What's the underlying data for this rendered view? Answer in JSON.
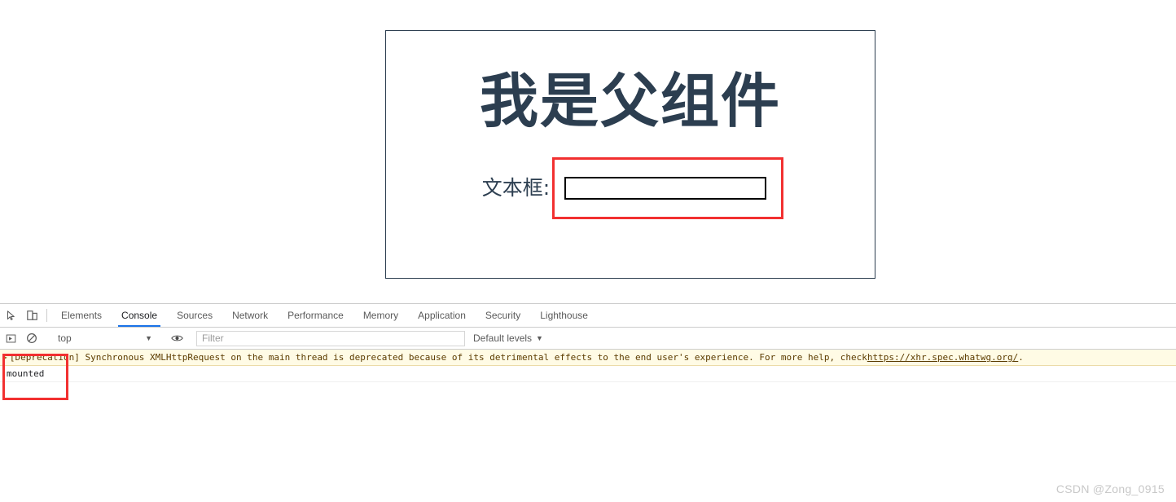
{
  "page": {
    "heading": "我是父组件",
    "field_label": "文本框:",
    "input_value": "",
    "input_placeholder": "",
    "card_border_color": "#2c3e50",
    "heading_color": "#2c3e50",
    "highlight_color": "#f23030"
  },
  "devtools": {
    "tabs": [
      {
        "label": "Elements",
        "active": false
      },
      {
        "label": "Console",
        "active": true
      },
      {
        "label": "Sources",
        "active": false
      },
      {
        "label": "Network",
        "active": false
      },
      {
        "label": "Performance",
        "active": false
      },
      {
        "label": "Memory",
        "active": false
      },
      {
        "label": "Application",
        "active": false
      },
      {
        "label": "Security",
        "active": false
      },
      {
        "label": "Lighthouse",
        "active": false
      }
    ],
    "active_tab_underline_color": "#1a73e8",
    "toolbar": {
      "context": "top",
      "context_caret": "▼",
      "filter_placeholder": "Filter",
      "filter_value": "",
      "levels": "Default levels",
      "levels_caret": "▼"
    },
    "icons": {
      "inspect": "inspect-element-icon",
      "device": "device-toolbar-icon",
      "execute": "execute-icon",
      "clear": "clear-console-icon",
      "eye": "live-expression-icon"
    },
    "messages": [
      {
        "type": "warning",
        "arrow": "▶",
        "text_before_link": "[Deprecation] Synchronous XMLHttpRequest on the main thread is deprecated because of its detrimental effects to the end user's experience. For more help, check ",
        "link": "https://xhr.spec.whatwg.org/",
        "text_after_link": ".",
        "background": "#fffbe5"
      },
      {
        "type": "log",
        "text": "mounted",
        "highlighted": true
      }
    ]
  },
  "watermark": "CSDN @Zong_0915"
}
